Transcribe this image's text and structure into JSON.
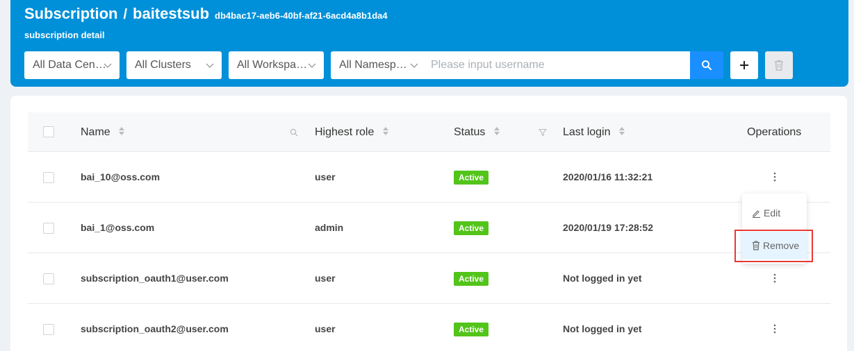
{
  "header": {
    "title": "Subscription",
    "separator": "/",
    "subscription_name": "baitestsub",
    "subscription_id": "db4bac17-aeb6-40bf-af21-6acd4a8b1da4",
    "subtitle": "subscription detail",
    "bg_color": "#0090d9"
  },
  "filters": [
    {
      "label": "All Data Cen…"
    },
    {
      "label": "All Clusters"
    },
    {
      "label": "All Workspa…"
    },
    {
      "label": "All Namesp…"
    }
  ],
  "search": {
    "placeholder": "Please input username",
    "button_icon": "search-icon"
  },
  "toolbar": {
    "add_icon": "plus-icon",
    "delete_icon": "trash-icon"
  },
  "table": {
    "columns": [
      "Name",
      "Highest role",
      "Status",
      "Last login",
      "Operations"
    ],
    "rows": [
      {
        "name": "bai_10@oss.com",
        "role": "user",
        "status": "Active",
        "last_login": "2020/01/16 11:32:21"
      },
      {
        "name": "bai_1@oss.com",
        "role": "admin",
        "status": "Active",
        "last_login": "2020/01/19 17:28:52"
      },
      {
        "name": "subscription_oauth1@user.com",
        "role": "user",
        "status": "Active",
        "last_login": "Not logged in yet"
      },
      {
        "name": "subscription_oauth2@user.com",
        "role": "user",
        "status": "Active",
        "last_login": "Not logged in yet"
      }
    ],
    "status_color": "#52c41a"
  },
  "row_menu": {
    "edit": "Edit",
    "remove": "Remove"
  },
  "colors": {
    "accent": "#1a8fff",
    "highlight": "#e53935"
  }
}
